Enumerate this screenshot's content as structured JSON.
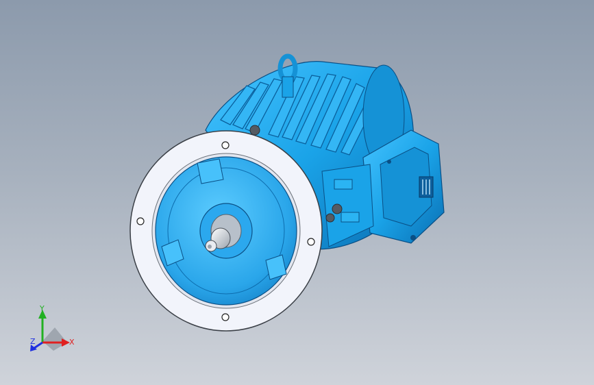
{
  "viewport": {
    "background_top": "#8c9aac",
    "background_bottom": "#cfd3da"
  },
  "model": {
    "body_color": "#1aa3e8",
    "body_dark": "#0a6fb3",
    "flange_color": "#f2f4fb",
    "shaft_color": "#d8dce3"
  },
  "triad": {
    "x_label": "X",
    "y_label": "Y",
    "z_label": "Z",
    "x_color": "#e02020",
    "y_color": "#22b022",
    "z_color": "#2030e0"
  }
}
